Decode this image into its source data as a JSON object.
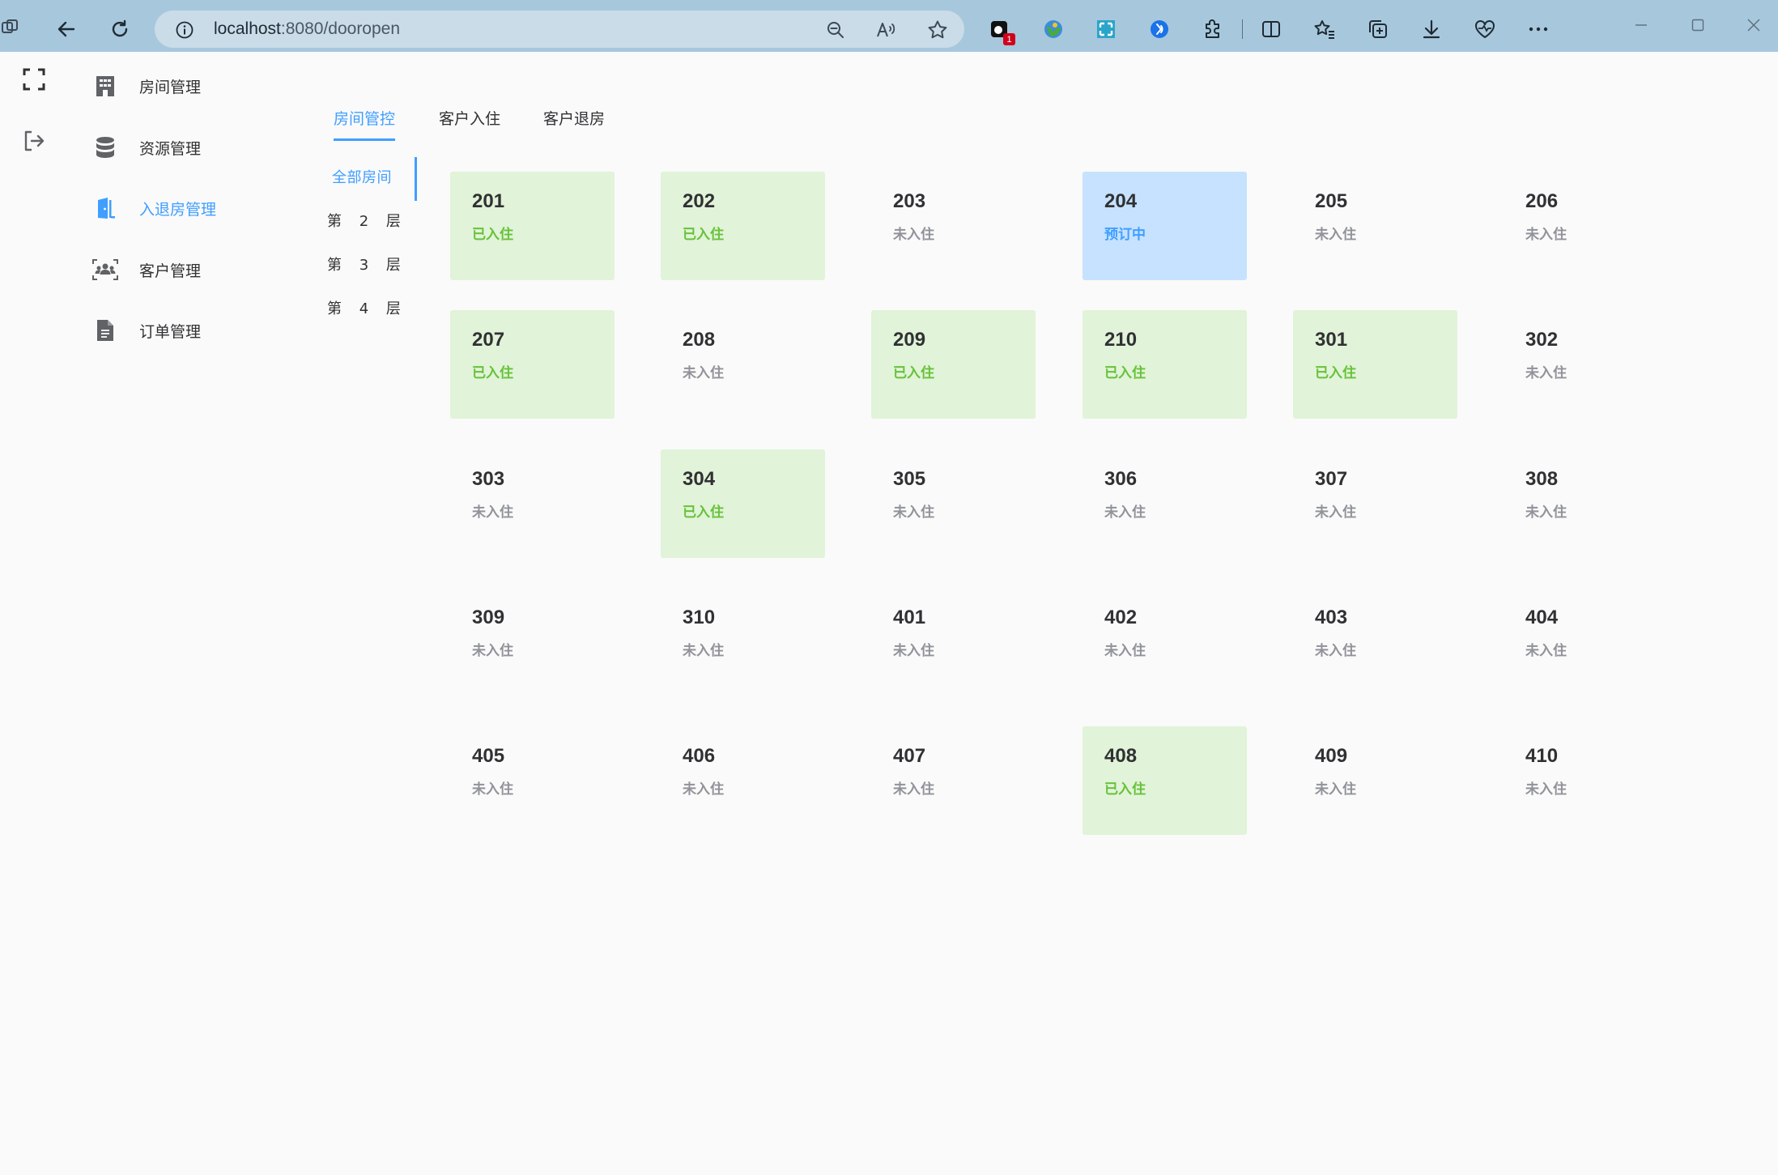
{
  "browser": {
    "url_host": "localhost",
    "url_path": ":8080/dooropen",
    "extension_badge": "1"
  },
  "sidebar": {
    "items": [
      {
        "label": "房间管理",
        "icon": "building-icon"
      },
      {
        "label": "资源管理",
        "icon": "database-icon"
      },
      {
        "label": "入退房管理",
        "icon": "door-icon",
        "active": true
      },
      {
        "label": "客户管理",
        "icon": "users-icon"
      },
      {
        "label": "订单管理",
        "icon": "document-icon"
      }
    ]
  },
  "tabs": [
    {
      "label": "房间管控",
      "active": true
    },
    {
      "label": "客户入住"
    },
    {
      "label": "客户退房"
    }
  ],
  "floors": [
    {
      "label": "全部房间",
      "active": true
    },
    {
      "label": "第 2 层"
    },
    {
      "label": "第 3 层"
    },
    {
      "label": "第 4 层"
    }
  ],
  "status_labels": {
    "occ": "已入住",
    "vac": "未入住",
    "res": "预订中"
  },
  "colors": {
    "accent": "#409eff",
    "occupied_bg": "#e1f3d8",
    "occupied_text": "#67c23a",
    "reserved_bg": "#c6e2ff",
    "vacant_text": "#909399"
  },
  "rooms": [
    {
      "number": "201",
      "status": "已入住"
    },
    {
      "number": "202",
      "status": "已入住"
    },
    {
      "number": "203",
      "status": "未入住"
    },
    {
      "number": "204",
      "status": "预订中"
    },
    {
      "number": "205",
      "status": "未入住"
    },
    {
      "number": "206",
      "status": "未入住"
    },
    {
      "number": "207",
      "status": "已入住"
    },
    {
      "number": "208",
      "status": "未入住"
    },
    {
      "number": "209",
      "status": "已入住"
    },
    {
      "number": "210",
      "status": "已入住"
    },
    {
      "number": "301",
      "status": "已入住"
    },
    {
      "number": "302",
      "status": "未入住"
    },
    {
      "number": "303",
      "status": "未入住"
    },
    {
      "number": "304",
      "status": "已入住"
    },
    {
      "number": "305",
      "status": "未入住"
    },
    {
      "number": "306",
      "status": "未入住"
    },
    {
      "number": "307",
      "status": "未入住"
    },
    {
      "number": "308",
      "status": "未入住"
    },
    {
      "number": "309",
      "status": "未入住"
    },
    {
      "number": "310",
      "status": "未入住"
    },
    {
      "number": "401",
      "status": "未入住"
    },
    {
      "number": "402",
      "status": "未入住"
    },
    {
      "number": "403",
      "status": "未入住"
    },
    {
      "number": "404",
      "status": "未入住"
    },
    {
      "number": "405",
      "status": "未入住"
    },
    {
      "number": "406",
      "status": "未入住"
    },
    {
      "number": "407",
      "status": "未入住"
    },
    {
      "number": "408",
      "status": "已入住"
    },
    {
      "number": "409",
      "status": "未入住"
    },
    {
      "number": "410",
      "status": "未入住"
    }
  ]
}
